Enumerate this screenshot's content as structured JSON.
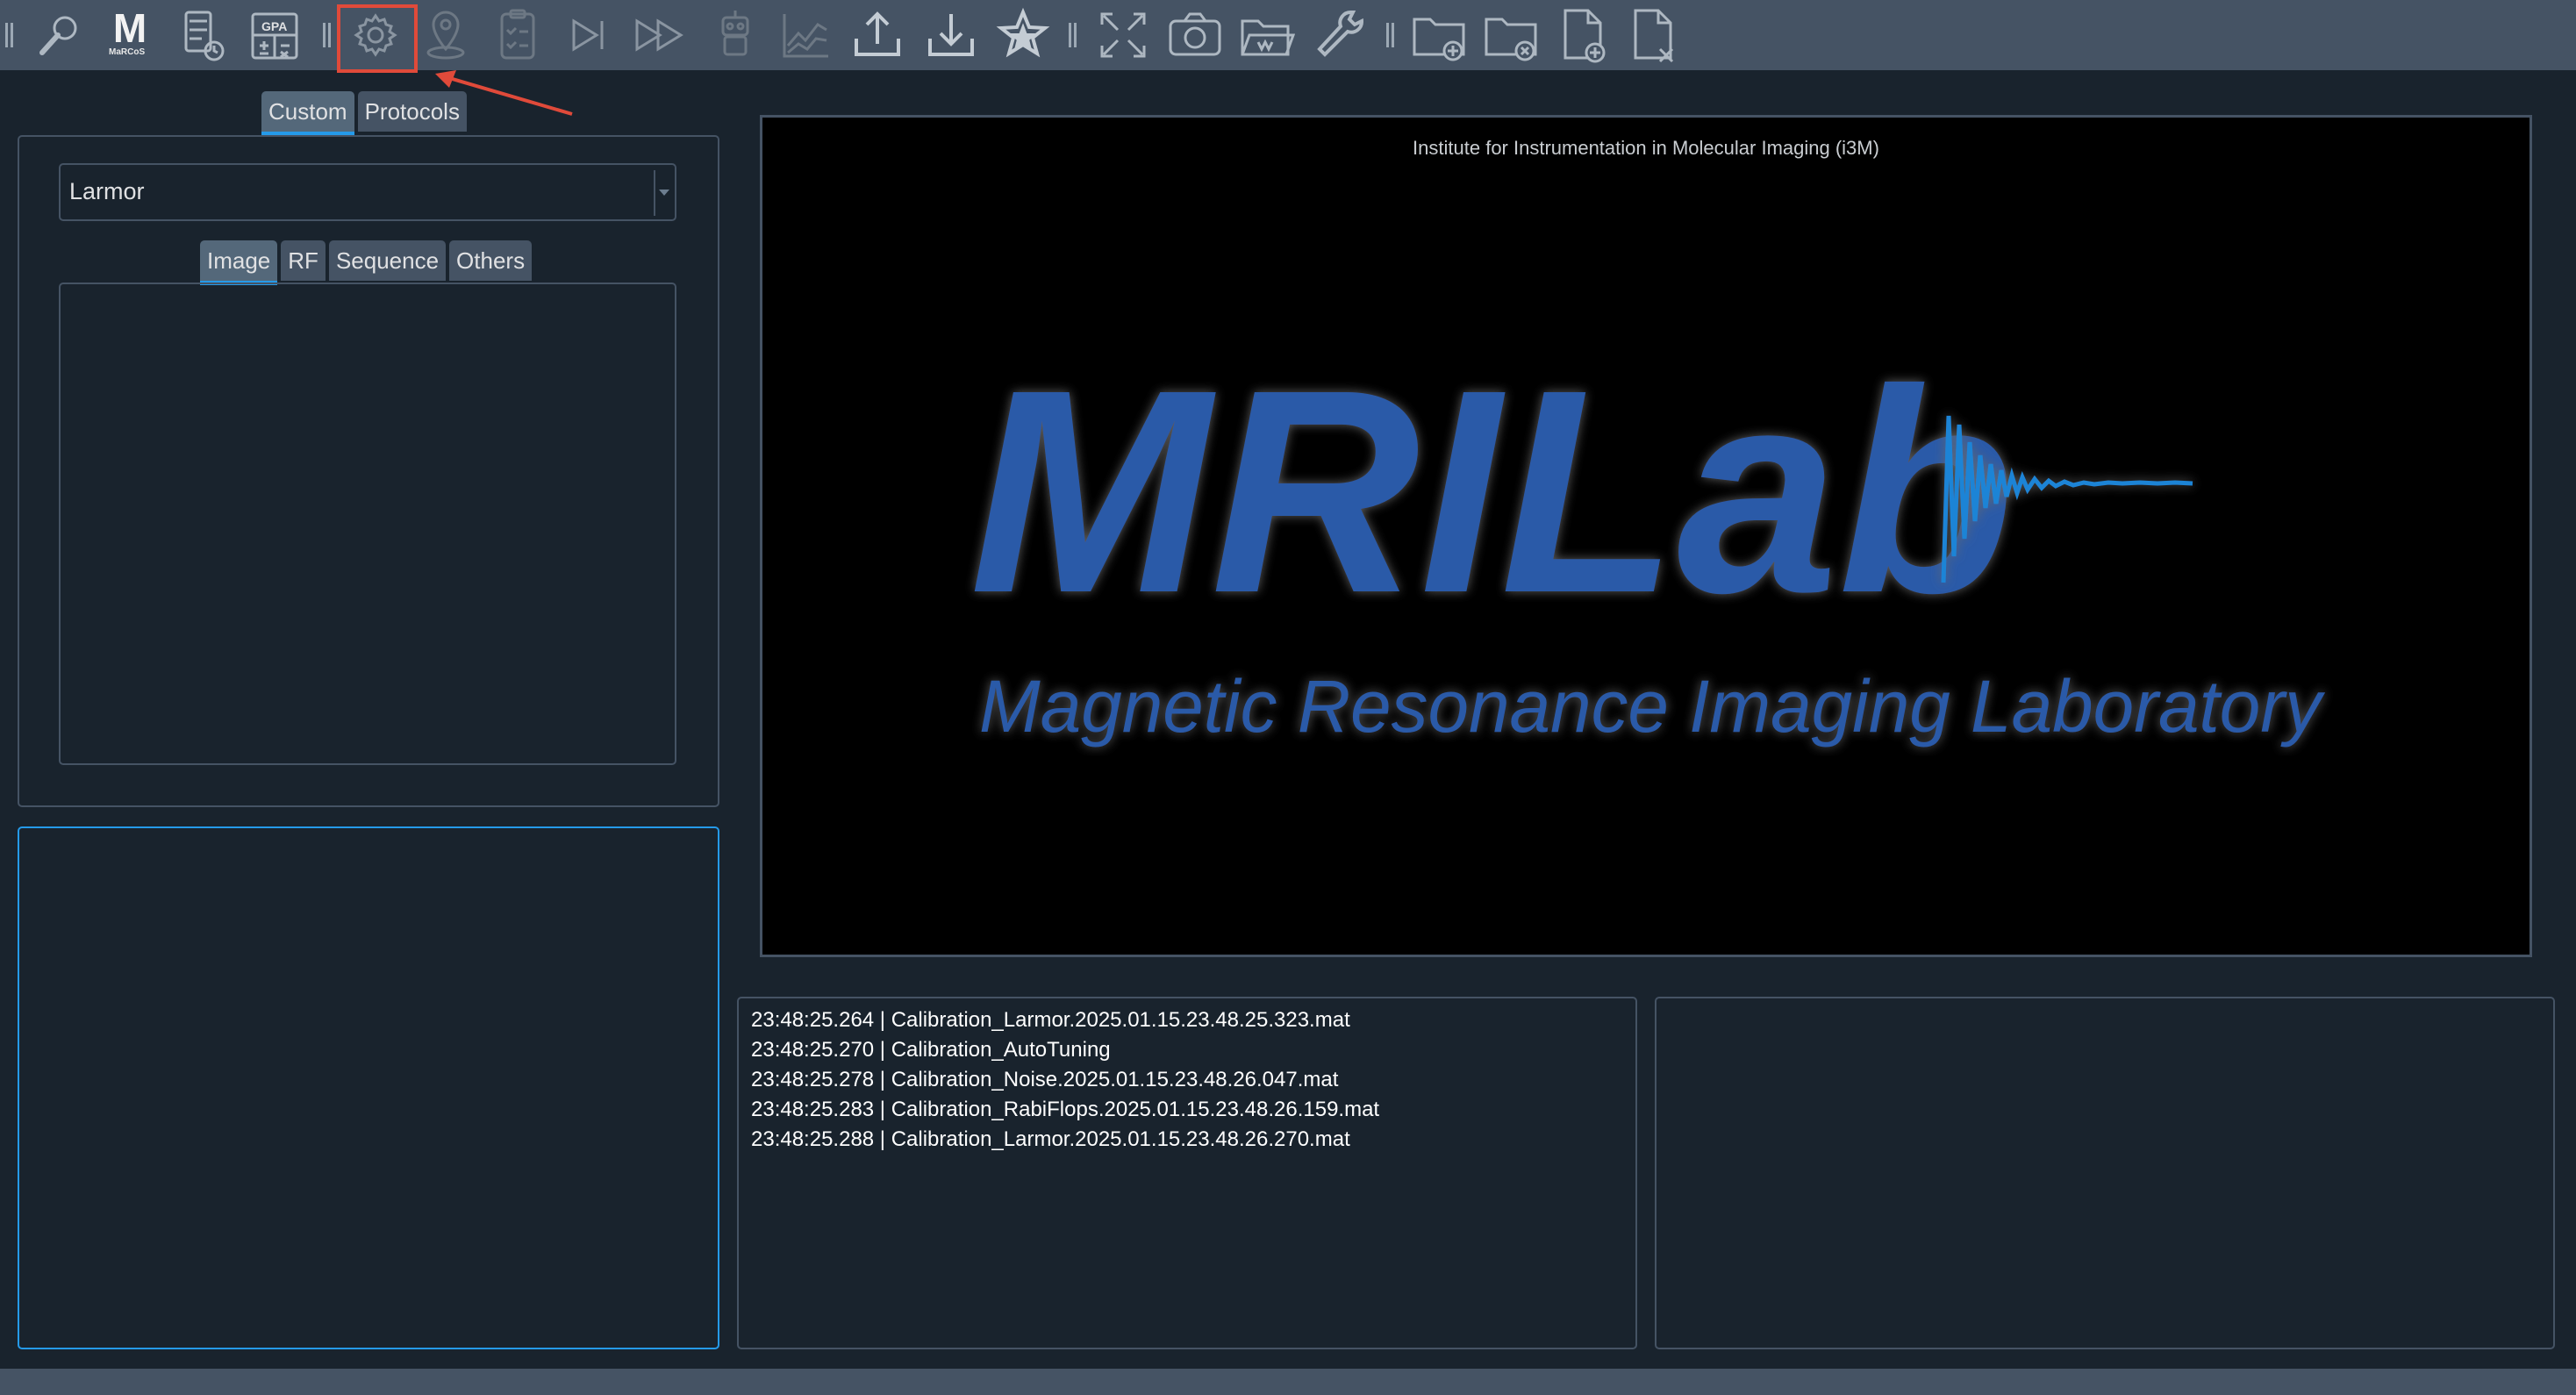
{
  "toolbar": {
    "icons": [
      "magnifier-icon",
      "marcos-logo-icon",
      "calculator-clock-icon",
      "gpa-calculator-icon",
      "gear-icon",
      "location-pin-icon",
      "checklist-icon",
      "play-next-icon",
      "fast-forward-icon",
      "robot-icon",
      "chart-icon",
      "upload-icon",
      "download-icon",
      "star-icon",
      "fullscreen-icon",
      "camera-icon",
      "folder-open-icon",
      "wrench-icon",
      "folder-add-icon",
      "folder-remove-icon",
      "file-add-icon",
      "file-remove-icon"
    ],
    "marcos_sub": "MaRCoS",
    "gpa_label": "GPA"
  },
  "left": {
    "tabs": [
      "Custom",
      "Protocols"
    ],
    "sequence_select": "Larmor",
    "inner_tabs": [
      "Image",
      "RF",
      "Sequence",
      "Others"
    ]
  },
  "logo": {
    "caption": "Institute for Instrumentation in Molecular Imaging (i3M)",
    "title": "MRILab",
    "subtitle": "Magnetic Resonance Imaging Laboratory"
  },
  "console": {
    "lines": [
      "23:48:25.264 | Calibration_Larmor.2025.01.15.23.48.25.323.mat",
      "23:48:25.270 | Calibration_AutoTuning",
      "23:48:25.278 | Calibration_Noise.2025.01.15.23.48.26.047.mat",
      "23:48:25.283 | Calibration_RabiFlops.2025.01.15.23.48.26.159.mat",
      "23:48:25.288 | Calibration_Larmor.2025.01.15.23.48.26.270.mat"
    ]
  },
  "colors": {
    "background": "#19232d",
    "toolbar": "#455364",
    "accent": "#259ae9",
    "highlight": "#e04a3a",
    "logo_blue": "#2b5aa8"
  }
}
